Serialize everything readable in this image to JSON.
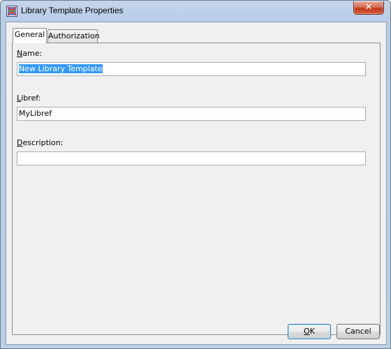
{
  "window": {
    "title": "Library Template Properties",
    "close_label": "✕"
  },
  "tabs": [
    {
      "label": "General",
      "selected": true
    },
    {
      "label": "Authorization",
      "selected": false
    }
  ],
  "form": {
    "name": {
      "label_mnemonic": "N",
      "label_rest": "ame:",
      "value": "New Library Template",
      "selected": true
    },
    "libref": {
      "label_mnemonic": "L",
      "label_rest": "ibref:",
      "value": "MyLibref"
    },
    "description": {
      "label_mnemonic": "D",
      "label_rest": "escription:",
      "value": ""
    }
  },
  "buttons": {
    "ok_mnemonic": "O",
    "ok_rest": "K",
    "cancel_label": "Cancel"
  },
  "colors": {
    "selection": "#3399ff",
    "close_button": "#c13a1c",
    "dialog_background": "#f0f0f0"
  },
  "icons": {
    "app": "library-template-icon",
    "close": "close-icon"
  }
}
